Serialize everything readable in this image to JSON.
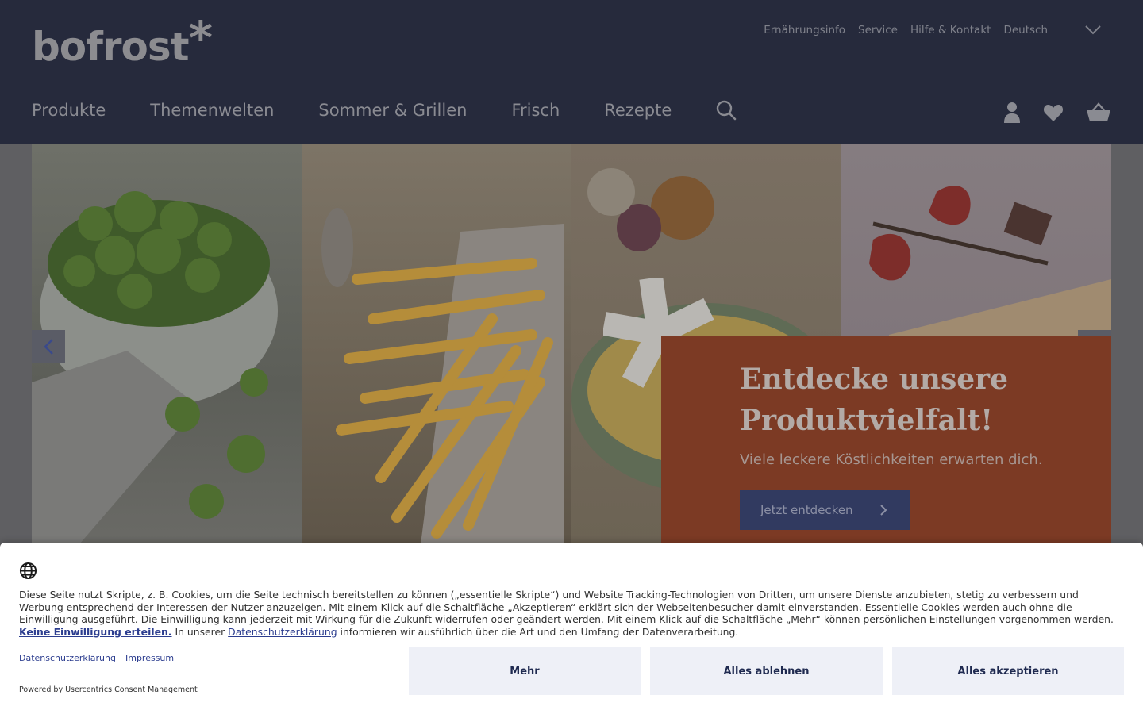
{
  "header": {
    "logo": "bofrost",
    "logo_star": "*",
    "topnav": [
      "Ernährungsinfo",
      "Service",
      "Hilfe & Kontakt",
      "Deutsch"
    ],
    "mainnav": [
      "Produkte",
      "Themenwelten",
      "Sommer & Grillen",
      "Frisch",
      "Rezepte"
    ],
    "icons": [
      "search-icon",
      "user-icon",
      "heart-icon",
      "basket-icon"
    ]
  },
  "hero": {
    "panels": [
      "broccoli",
      "fries",
      "onion-pasta",
      "strawberry-ice-cream"
    ],
    "title": "Entdecke unsere Produktvielfalt!",
    "subtitle": "Viele leckere Köstlichkeiten erwarten dich.",
    "cta": "Jetzt entdecken",
    "promo_color": "#a34a2d",
    "cta_color": "#3b4a8c"
  },
  "consent": {
    "text_1": "Diese Seite nutzt Skripte, z. B. Cookies, um die Seite technisch bereitstellen zu können („essentielle Skripte“) und Website Tracking-Technologien von Dritten, um unsere Dienste anzubieten, stetig zu verbessern und Werbung entsprechend der Interessen der Nutzer anzuzeigen. Mit einem Klick auf die Schaltfläche „Akzeptieren“ erklärt sich der Webseitenbesucher damit einverstanden. Essentielle Cookies werden auch ohne die Einwilligung ausgeführt. Die Einwilligung kann jederzeit mit Wirkung für die Zukunft widerrufen oder geändert werden. Mit einem Klick auf die Schaltfläche „Mehr“ können persönlichen Einstellungen vorgenommen werden. ",
    "no_consent_link": "Keine Einwilligung erteilen.",
    "text_2": " In unserer ",
    "privacy_inline_link": "Datenschutzerklärung",
    "text_3": " informieren wir ausführlich über die Art und den Umfang der Datenverarbeitung.",
    "links": [
      "Datenschutzerklärung",
      "Impressum"
    ],
    "powered": "Powered by Usercentrics Consent Management",
    "buttons": {
      "more": "Mehr",
      "deny": "Alles ablehnen",
      "accept": "Alles akzeptieren"
    }
  }
}
